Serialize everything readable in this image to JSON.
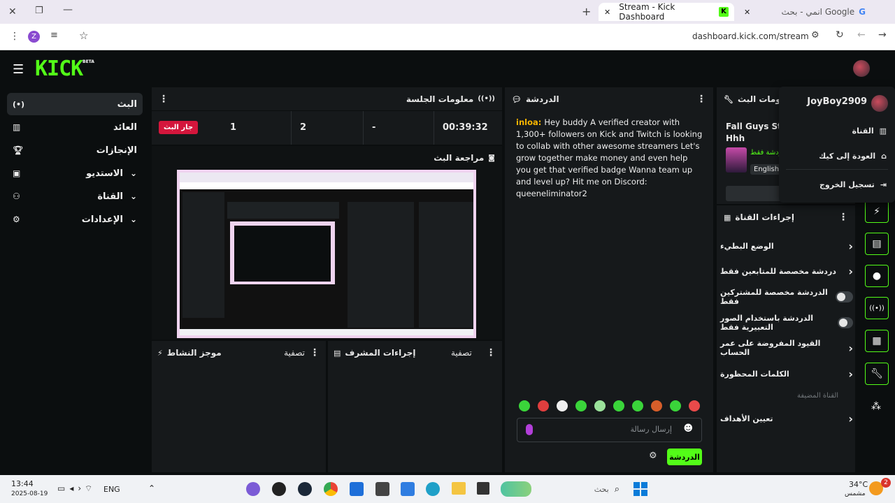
{
  "browser": {
    "tabs": [
      {
        "title": "Stream - Kick Dashboard",
        "active": true
      },
      {
        "title": "انمي - بحث Google",
        "active": false
      }
    ],
    "url": "dashboard.kick.com/stream",
    "profile_initial": "Z"
  },
  "brand": {
    "logo": "KICK",
    "beta": "BETA",
    "accent": "#53fc18",
    "live": "#d4163c"
  },
  "sidebar": {
    "items": [
      {
        "label": "البث",
        "icon": "broadcast-icon"
      },
      {
        "label": "العائد",
        "icon": "chart-icon"
      },
      {
        "label": "الإنجازات",
        "icon": "trophy-icon"
      },
      {
        "label": "الاستديو",
        "icon": "studio-icon"
      },
      {
        "label": "القناة",
        "icon": "channel-icon"
      },
      {
        "label": "الإعدادات",
        "icon": "gear-icon"
      }
    ]
  },
  "session": {
    "title": "معلومات الجلسة",
    "live_badge": "جار البث",
    "stats": [
      "1",
      "2",
      "-",
      "00:39:32"
    ]
  },
  "preview": {
    "title": "مراجعة البث"
  },
  "activity": {
    "title": "موجز النشاط",
    "filter": "تصفية"
  },
  "modactions": {
    "title": "إجراءات المشرف",
    "filter": "تصفية"
  },
  "chat": {
    "title": "الدردشة",
    "username": "inloa",
    "message": "Hey buddy A verified creator with 1,300+ followers on Kick and Twitch is looking to collab with other awesome streamers Let's grow together make money and even help you get that verified badge Wanna team up and level up? Hit me on Discord: queeneliminator2",
    "placeholder": "إرسال رسالة",
    "send_label": "الدردشة"
  },
  "streaminfo": {
    "title": "معلومات البث",
    "stream_title": "Fall Guys Stre... Alkhout Hhh",
    "tag": "دردشة فقط",
    "language": "English"
  },
  "channel_actions": {
    "title": "إجراءات القناة",
    "items": [
      {
        "label": "الوضع البطيء",
        "control": "chevron"
      },
      {
        "label": "دردشة مخصصة للمتابعين فقط",
        "control": "chevron"
      },
      {
        "label": "الدردشة مخصصة للمشتركين فقط",
        "control": "toggle"
      },
      {
        "label": "الدردشة باستخدام الصور التعبيرية فقط",
        "control": "toggle"
      },
      {
        "label": "القيود المفروضة على عمر الحساب",
        "control": "chevron"
      },
      {
        "label": "الكلمات المحظورة",
        "control": "chevron"
      }
    ],
    "hosted_label": "القناة المضيفة",
    "set_goals": "تعيين الأهداف"
  },
  "user_menu": {
    "username": "JoyBoy2909",
    "items": [
      "القناة",
      "العودة إلى كيك",
      "تسجيل الخروج"
    ]
  },
  "taskbar": {
    "time": "13:44",
    "date": "2025-08-19",
    "lang": "ENG",
    "search": "بحث",
    "weather_temp": "34°C",
    "weather_desc": "مشمس",
    "notif_count": "2"
  }
}
